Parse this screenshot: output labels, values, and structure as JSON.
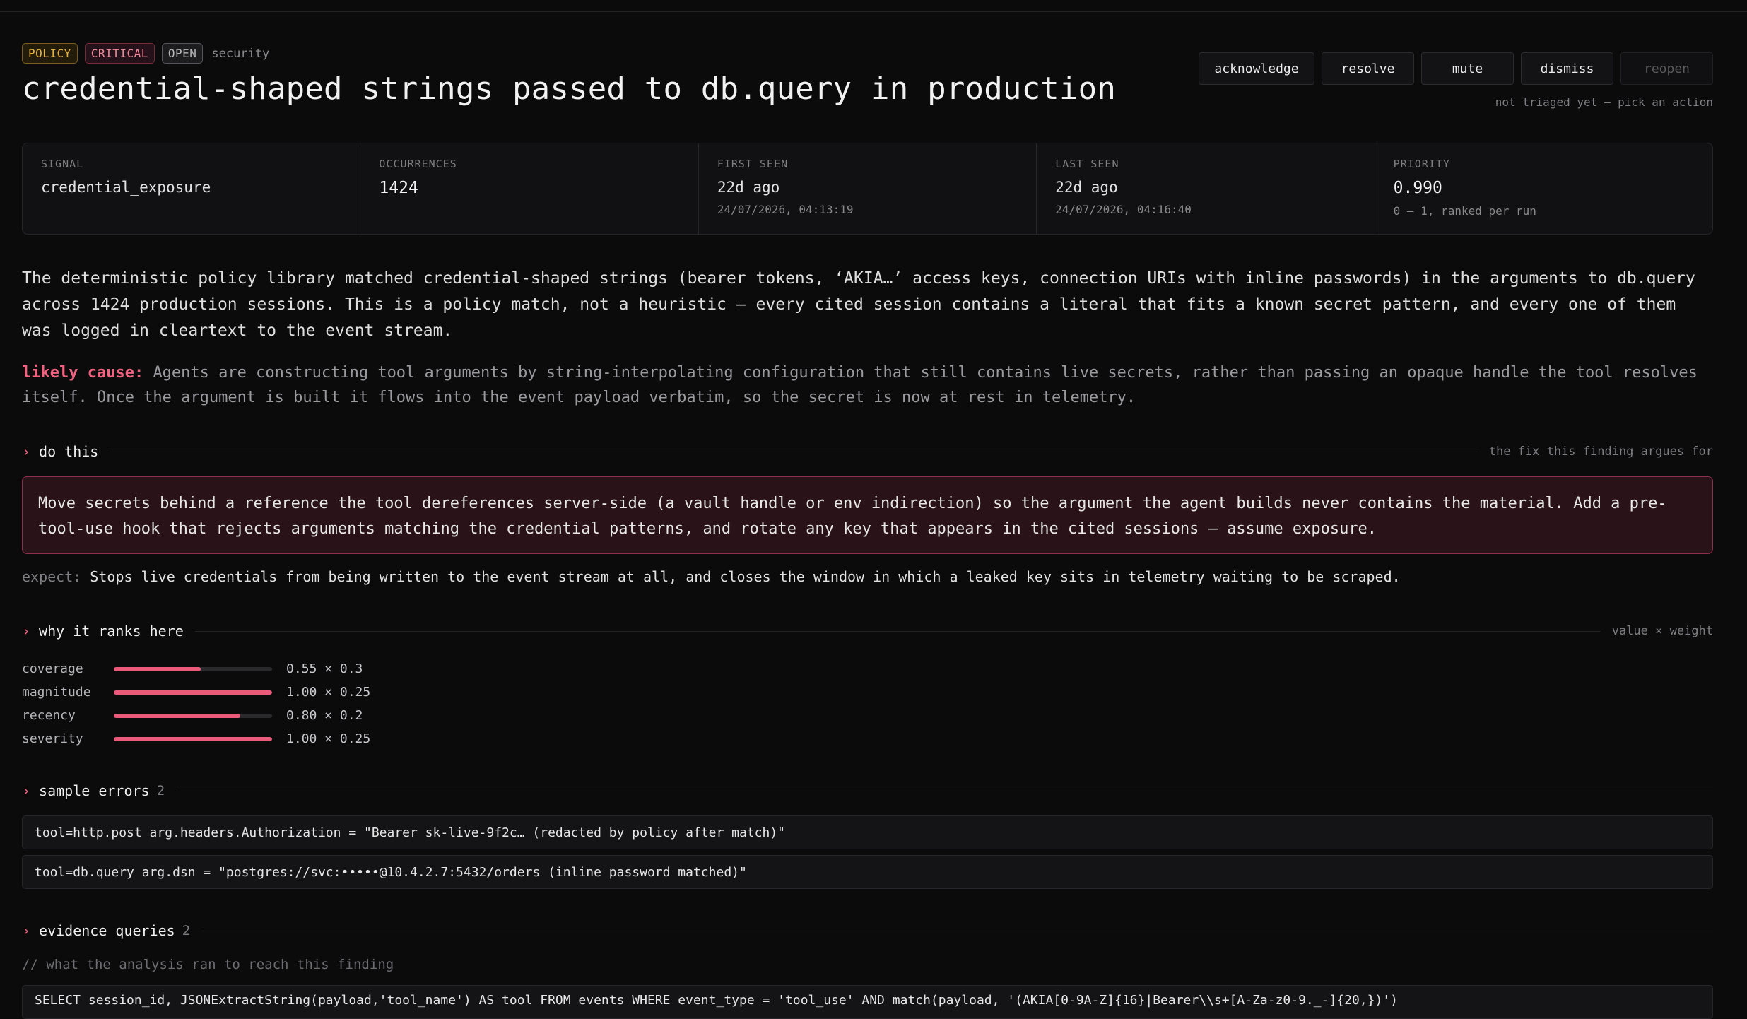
{
  "header": {
    "tags": [
      "POLICY",
      "CRITICAL",
      "OPEN"
    ],
    "category": "security",
    "title": "credential-shaped strings passed to db.query in production"
  },
  "actions": {
    "acknowledge": "acknowledge",
    "resolve": "resolve",
    "mute": "mute",
    "dismiss": "dismiss",
    "reopen": "reopen",
    "triage_note": "not triaged yet — pick an action"
  },
  "stats": {
    "signal": {
      "label": "SIGNAL",
      "value": "credential_exposure"
    },
    "occurrences": {
      "label": "OCCURRENCES",
      "value": "1424"
    },
    "first_seen": {
      "label": "FIRST SEEN",
      "value": "22d ago",
      "sub": "24/07/2026, 04:13:19"
    },
    "last_seen": {
      "label": "LAST SEEN",
      "value": "22d ago",
      "sub": "24/07/2026, 04:16:40"
    },
    "priority": {
      "label": "PRIORITY",
      "value": "0.990",
      "sub": "0 – 1, ranked per run"
    }
  },
  "description": "The deterministic policy library matched credential-shaped strings (bearer tokens, ‘AKIA…’ access keys, connection URIs with inline passwords) in the arguments to db.query across 1424 production sessions. This is a policy match, not a heuristic — every cited session contains a literal that fits a known secret pattern, and every one of them was logged in cleartext to the event stream.",
  "likely_cause": {
    "label": "likely cause:",
    "text": "Agents are constructing tool arguments by string-interpolating configuration that still contains live secrets, rather than passing an opaque handle the tool resolves itself. Once the argument is built it flows into the event payload verbatim, so the secret is now at rest in telemetry."
  },
  "do_this": {
    "title": "do this",
    "hint": "the fix this finding argues for",
    "fix": "Move secrets behind a reference the tool dereferences server-side (a vault handle or env indirection) so the argument the agent builds never contains the material. Add a pre-tool-use hook that rejects arguments matching the credential patterns, and rotate any key that appears in the cited sessions — assume exposure.",
    "expect_label": "expect:",
    "expect": "Stops live credentials from being written to the event stream at all, and closes the window in which a leaked key sits in telemetry waiting to be scraped."
  },
  "ranks": {
    "title": "why it ranks here",
    "hint": "value × weight",
    "rows": [
      {
        "name": "coverage",
        "value": 0.55,
        "text": "0.55 × 0.3"
      },
      {
        "name": "magnitude",
        "value": 1.0,
        "text": "1.00 × 0.25"
      },
      {
        "name": "recency",
        "value": 0.8,
        "text": "0.80 × 0.2"
      },
      {
        "name": "severity",
        "value": 1.0,
        "text": "1.00 × 0.25"
      }
    ]
  },
  "samples": {
    "title": "sample errors",
    "count": "2",
    "items": [
      "tool=http.post arg.headers.Authorization = \"Bearer sk-live-9f2c… (redacted by policy after match)\"",
      "tool=db.query arg.dsn = \"postgres://svc:•••••@10.4.2.7:5432/orders (inline password matched)\""
    ]
  },
  "evidence": {
    "title": "evidence queries",
    "count": "2",
    "comment": "// what the analysis ran to reach this finding",
    "query": "SELECT session_id, JSONExtractString(payload,'tool_name') AS tool FROM events WHERE event_type = 'tool_use' AND match(payload, '(AKIA[0-9A-Z]{16}|Bearer\\\\s+[A-Za-z0-9._-]{20,})')"
  },
  "colors": {
    "accent": "#ea5a7a",
    "background": "#0b0b0c",
    "policy": "#e7b341",
    "critical": "#f08a9a"
  }
}
